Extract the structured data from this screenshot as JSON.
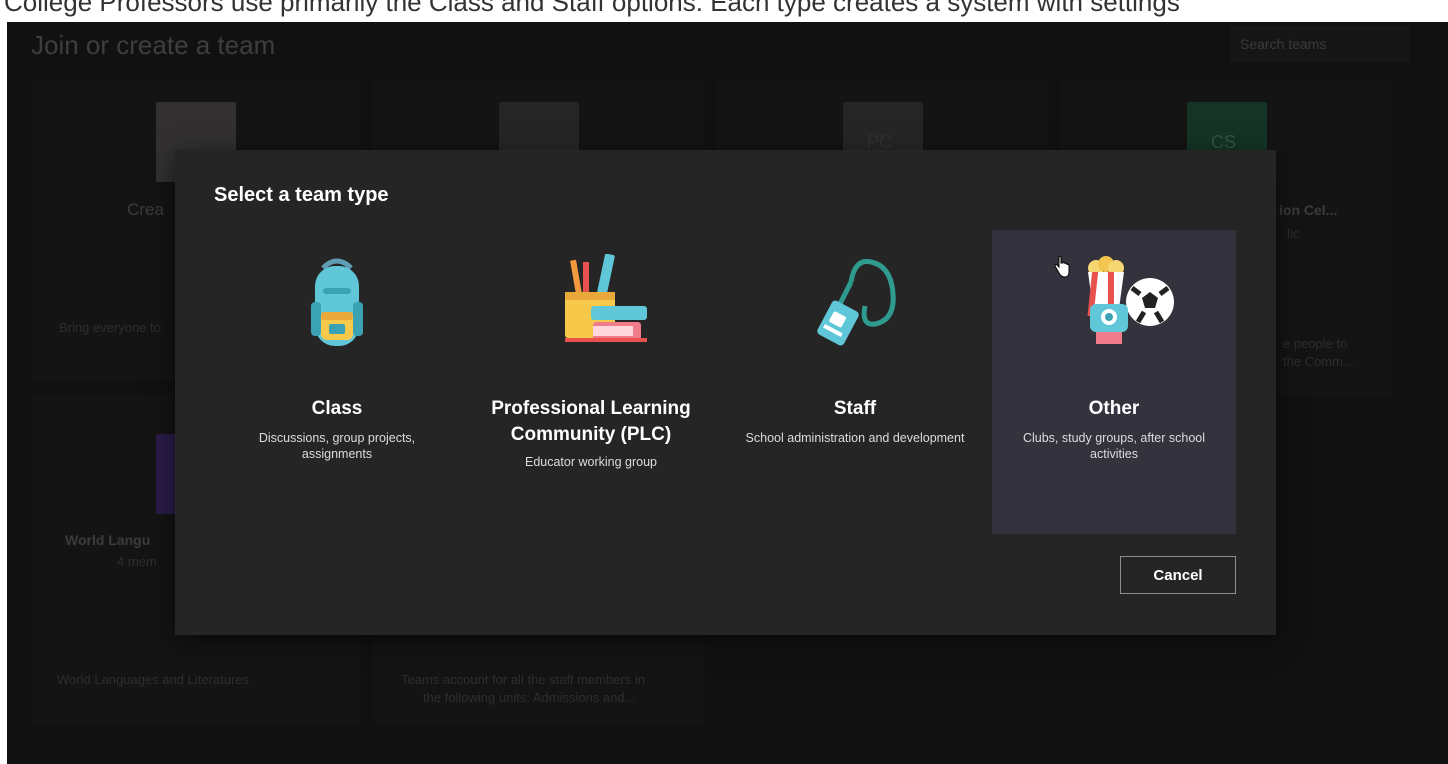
{
  "caption": {
    "text": "College Professors use primarily the Class and Staff options. Each type creates a system with settings"
  },
  "background": {
    "title": "Join or create a team",
    "search_placeholder": "Search teams",
    "cards": [
      {
        "label": "Crea",
        "desc": "Bring everyone to"
      },
      {
        "tile_text": ""
      },
      {
        "tile_text": "PC"
      },
      {
        "tile_text": "CS",
        "label": "ion Cel...",
        "sub": "lic",
        "desc_line1": "e people to",
        "desc_line2": "the Comm..."
      },
      {
        "label": "World Langu",
        "sub": "4 mem",
        "desc": "World Languages and Literatures"
      },
      {
        "desc_line1": "Teams account for all the staff members in",
        "desc_line2": "the following units: Admissions and..."
      }
    ]
  },
  "dialog": {
    "title": "Select a team type",
    "types": [
      {
        "name": "Class",
        "description": "Discussions, group projects, assignments",
        "icon": "backpack-icon"
      },
      {
        "name": "Professional Learning Community (PLC)",
        "description": "Educator working group",
        "icon": "books-pencils-icon"
      },
      {
        "name": "Staff",
        "description": "School administration and development",
        "icon": "lanyard-badge-icon"
      },
      {
        "name": "Other",
        "description": "Clubs, study groups, after school activities",
        "icon": "popcorn-soccer-camera-icon",
        "selected": true
      }
    ],
    "cancel_label": "Cancel"
  },
  "colors": {
    "app_bg": "#1b1a1a",
    "dialog_bg": "#262525",
    "selected_card": "#33323d",
    "text_primary": "#ffffff",
    "accent_green": "#2f7d5a",
    "accent_purple": "#5b3aa0"
  }
}
